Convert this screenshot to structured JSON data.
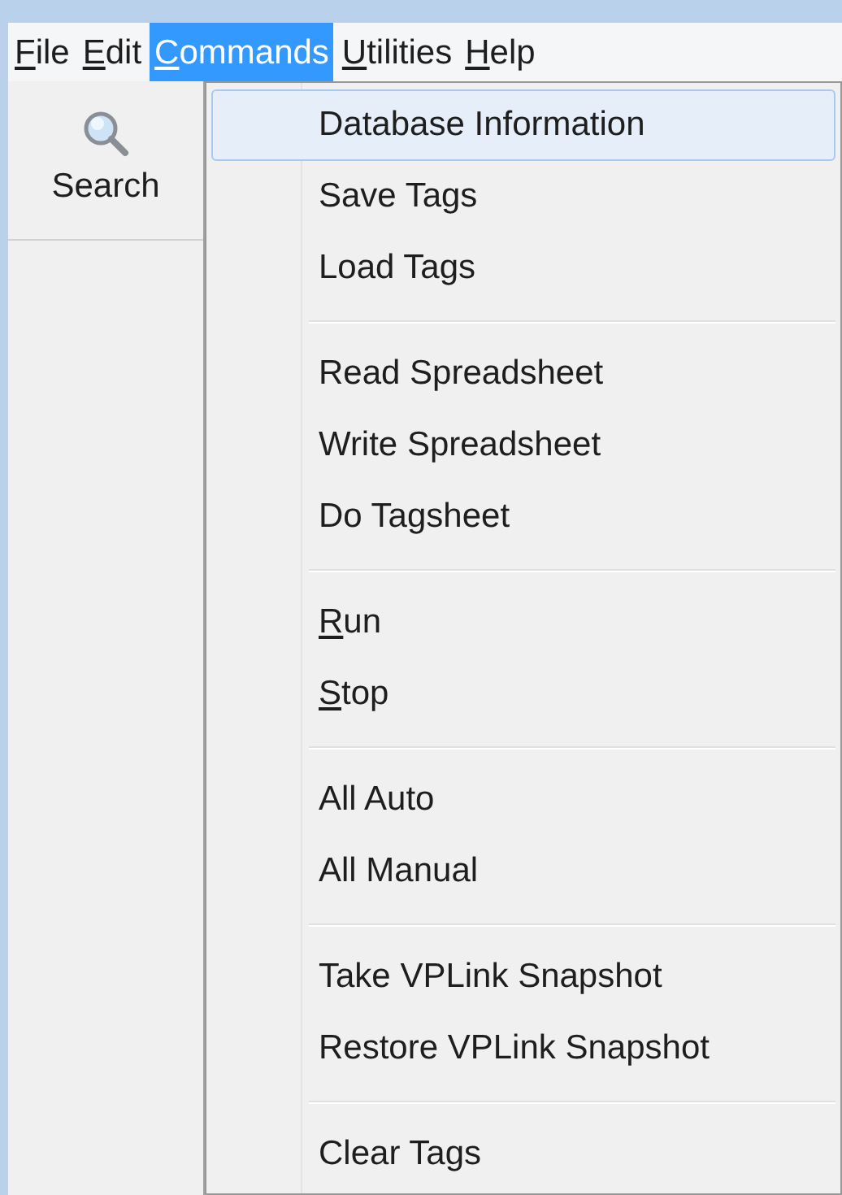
{
  "menu_bar": [
    {
      "label": "File",
      "underline_first": true,
      "selected": false
    },
    {
      "label": "Edit",
      "underline_first": true,
      "selected": false
    },
    {
      "label": "Commands",
      "underline_first": true,
      "selected": true
    },
    {
      "label": "Utilities",
      "underline_first": true,
      "selected": false
    },
    {
      "label": "Help",
      "underline_first": true,
      "selected": false
    }
  ],
  "toolbar": [
    {
      "label": "Search"
    }
  ],
  "dropdown": [
    [
      {
        "label": "Database Information",
        "underline_first": false,
        "selected": true
      },
      {
        "label": "Save Tags",
        "underline_first": false,
        "selected": false
      },
      {
        "label": "Load Tags",
        "underline_first": false,
        "selected": false
      }
    ],
    [
      {
        "label": "Read Spreadsheet",
        "underline_first": false,
        "selected": false
      },
      {
        "label": "Write Spreadsheet",
        "underline_first": false,
        "selected": false
      },
      {
        "label": "Do Tagsheet",
        "underline_first": false,
        "selected": false
      }
    ],
    [
      {
        "label": "Run",
        "underline_first": true,
        "selected": false
      },
      {
        "label": "Stop",
        "underline_first": true,
        "selected": false
      }
    ],
    [
      {
        "label": "All Auto",
        "underline_first": false,
        "selected": false
      },
      {
        "label": "All Manual",
        "underline_first": false,
        "selected": false
      }
    ],
    [
      {
        "label": "Take VPLink Snapshot",
        "underline_first": false,
        "selected": false
      },
      {
        "label": "Restore VPLink Snapshot",
        "underline_first": false,
        "selected": false
      }
    ],
    [
      {
        "label": "Clear Tags",
        "underline_first": false,
        "selected": false
      }
    ]
  ]
}
